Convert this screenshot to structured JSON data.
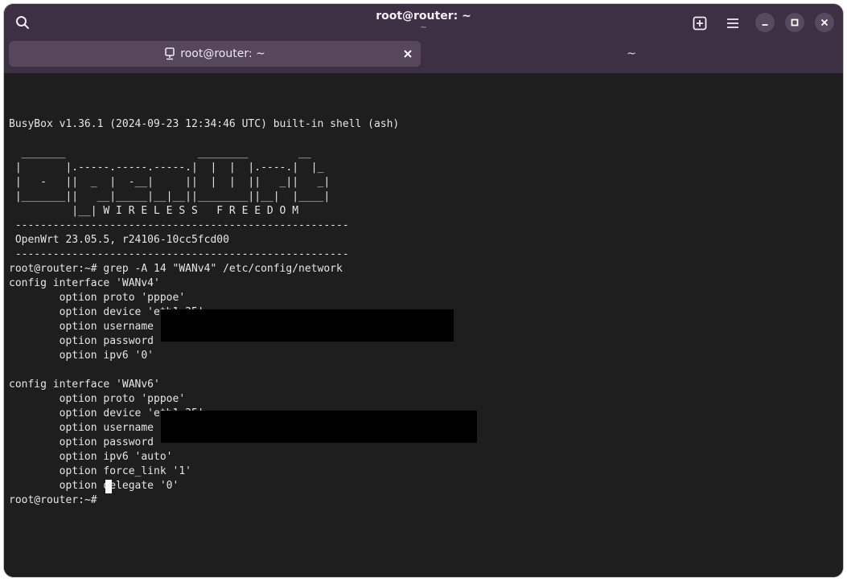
{
  "window": {
    "title": "root@router: ~",
    "subtitle": "~"
  },
  "tabs": [
    {
      "label": "root@router: ~",
      "active": true
    },
    {
      "label": "~",
      "active": false
    }
  ],
  "icons": {
    "search": "search-icon",
    "new_tab": "new-tab-icon",
    "menu": "hamburger-menu-icon",
    "minimize": "minimize-icon",
    "maximize": "maximize-icon",
    "close": "close-icon",
    "terminal": "terminal-icon",
    "tab_close": "tab-close-icon"
  },
  "colors": {
    "titlebar": "#3d2f44",
    "active_tab": "#56475d",
    "terminal_bg": "#1e1e1e",
    "terminal_fg": "#e6e6e6"
  },
  "terminal": {
    "lines": [
      "",
      "BusyBox v1.36.1 (2024-09-23 12:34:46 UTC) built-in shell (ash)",
      "",
      "  _______                     ________        __",
      " |       |.-----.-----.-----.|  |  |  |.----.|  |_",
      " |   -   ||  _  |  -__|     ||  |  |  ||   _||   _|",
      " |_______||   __|_____|__|__||________||__|  |____|",
      "          |__| W I R E L E S S   F R E E D O M",
      " -----------------------------------------------------",
      " OpenWrt 23.05.5, r24106-10cc5fcd00",
      " -----------------------------------------------------",
      "root@router:~# grep -A 14 \"WANv4\" /etc/config/network",
      "config interface 'WANv4'",
      "        option proto 'pppoe'",
      "        option device 'eth1.35'",
      "        option username",
      "        option password",
      "        option ipv6 '0'",
      "",
      "config interface 'WANv6'",
      "        option proto 'pppoe'",
      "        option device 'eth1.35'",
      "        option username",
      "        option password",
      "        option ipv6 'auto'",
      "        option force_link '1'",
      "        option delegate '0'",
      "root@router:~# "
    ]
  }
}
